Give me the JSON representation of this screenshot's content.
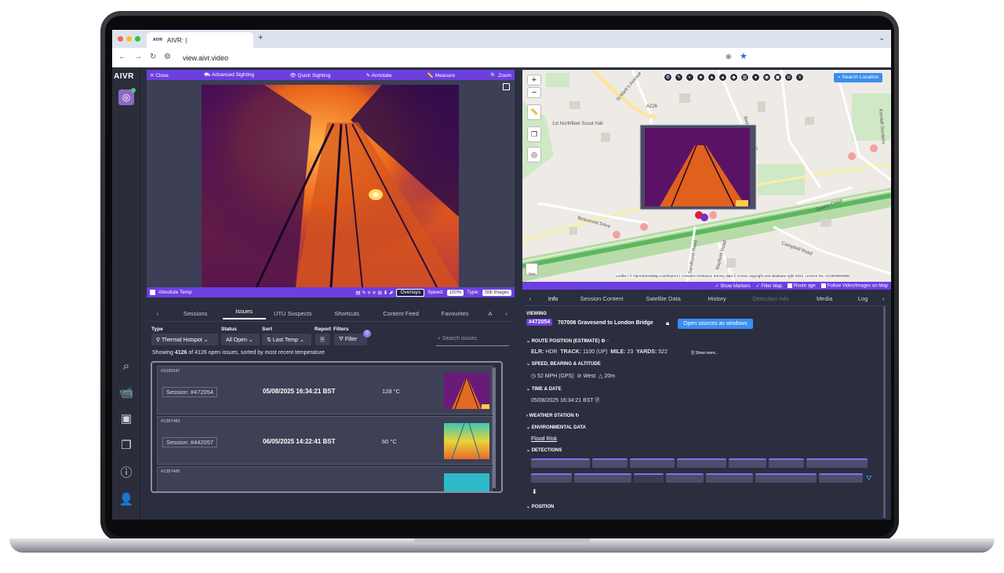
{
  "browser": {
    "tab_title": "AIVR: |",
    "tab_favicon": "AIVR",
    "url": "view.aivr.video",
    "new_tab": "+",
    "tab_menu": "⌄"
  },
  "rail": {
    "logo": "AIVR",
    "icons": [
      "search-icon",
      "camera-icon",
      "images-icon",
      "layers-icon",
      "help-icon",
      "user-icon"
    ]
  },
  "video_toolbar": {
    "close": "✕ Close",
    "advanced": "Advanced Sighting",
    "quick": "Quick Sighting",
    "annotate": "Annotate",
    "measure": "Measure",
    "zoom": "Zoom"
  },
  "video_bottom": {
    "absolute_temp": "Absolute Temp",
    "overlays": "Overlays",
    "speed_label": "Speed:",
    "speed_value": "100%",
    "type_label": "Type:",
    "type_value": "Still Images"
  },
  "left_tabs": {
    "prev": "‹",
    "sessions": "Sessions",
    "issues": "Issues",
    "utu": "UTU Suspects",
    "shortcuts": "Shortcuts",
    "content_feed": "Content Feed",
    "favourites": "Favourites",
    "more": "A",
    "next": "›"
  },
  "filters": {
    "type_label": "Type",
    "type_value": "Thermal Hotspot",
    "status_label": "Status",
    "status_value": "All Open",
    "sort_label": "Sort",
    "sort_value": "Last Temp",
    "report_label": "Report",
    "filters_label": "Filters",
    "filter_button": "Filter",
    "filter_count": "0",
    "search_placeholder": "Search issues"
  },
  "summary": {
    "prefix": "Showing ",
    "count": "4126",
    "suffix": " of 4126 open issues, sorted by most recent temperature"
  },
  "issues": [
    {
      "id": "#1695947",
      "session": "Session: #472054",
      "date": "05/08/2025 16:34:21 BST",
      "temp": "128 °C"
    },
    {
      "id": "#1387483",
      "session": "Session: #442057",
      "date": "06/05/2025 14:22:41 BST",
      "temp": "60 °C"
    },
    {
      "id": "#1387486",
      "session": "",
      "date": "",
      "temp": ""
    }
  ],
  "map": {
    "zoom_in": "+",
    "zoom_out": "−",
    "search_location": "Search Location",
    "attribution": "Leaflet | © OpenStreetMap contributors | Contains Ordnance Survey data © Crown copyright and database right 2024. Licence No. AC0000849962",
    "streets": [
      "St Mark's Avenue",
      "A226",
      "Beaumont Drive",
      "Quarry Close",
      "Campbell Road",
      "Mayfield Road",
      "Sandhurst Road",
      "Beaumont Grove",
      "Kendall Gardens",
      "1st Northfleet Scout Hall"
    ],
    "osm_badge": "Stats"
  },
  "map_bar": {
    "show_markers": "✓ Show Markers",
    "filter_map": "✓ Filter Map",
    "route_age": "Route age",
    "follow": "Follow Video/Images on Map"
  },
  "right_tabs": {
    "prev": "‹",
    "info": "Info",
    "session_content": "Session Content",
    "satellite": "Satellite Data",
    "history": "History",
    "detection": "Detection Info",
    "media": "Media",
    "log": "Log",
    "next": "›"
  },
  "info": {
    "viewing_label": "VIEWING",
    "session_tag": "#472054",
    "session_name": "707006 Gravesend to London Bridge",
    "open_sources": "Open sources as windows",
    "route_position": "ROUTE POSITION (ESTIMATE)",
    "elr_label": "ELR:",
    "elr_value": "HDR",
    "track_label": "TRACK:",
    "track_value": "1100 (UP)",
    "mile_label": "MILE:",
    "mile_value": "23",
    "yards_label": "YARDS:",
    "yards_value": "522",
    "show_more": "Show more...",
    "speed_heading": "SPEED, BEARING & ALTITUDE",
    "speed": "52 MPH (GPS)",
    "bearing": "West",
    "altitude": "20m",
    "time_heading": "TIME & DATE",
    "time_value": "05/08/2025 16:34:21 BST",
    "weather": "WEATHER STATION",
    "environment": "ENVIRONMENTAL DATA",
    "flood": "Flood Risk",
    "detections": "DETECTIONS",
    "position": "POSITION"
  },
  "colors": {
    "accent": "#6d3fe0",
    "panel": "#2b2e3f",
    "button_blue": "#3a8ef0"
  }
}
